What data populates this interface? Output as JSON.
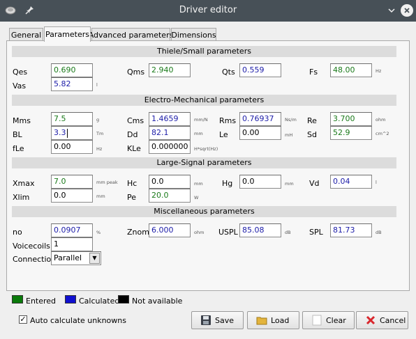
{
  "window": {
    "title": "Driver editor"
  },
  "tabs": [
    "General",
    "Parameters",
    "Advanced parameters",
    "Dimensions"
  ],
  "sections": {
    "ts": "Thiele/Small parameters",
    "em": "Electro-Mechanical parameters",
    "ls": "Large-Signal parameters",
    "misc": "Miscellaneous parameters"
  },
  "params": {
    "qes": {
      "label": "Qes",
      "value": "0.690",
      "unit": ""
    },
    "qms": {
      "label": "Qms",
      "value": "2.940",
      "unit": ""
    },
    "qts": {
      "label": "Qts",
      "value": "0.559",
      "unit": ""
    },
    "fs": {
      "label": "Fs",
      "value": "48.00",
      "unit": "Hz"
    },
    "vas": {
      "label": "Vas",
      "value": "5.82",
      "unit": "l"
    },
    "mms": {
      "label": "Mms",
      "value": "7.5",
      "unit": "g"
    },
    "cms": {
      "label": "Cms",
      "value": "1.4659",
      "unit": "mm/N"
    },
    "rms": {
      "label": "Rms",
      "value": "0.76937",
      "unit": "Ns/m"
    },
    "re": {
      "label": "Re",
      "value": "3.700",
      "unit": "ohm"
    },
    "bl": {
      "label": "BL",
      "value": "3.3",
      "unit": "Tm"
    },
    "dd": {
      "label": "Dd",
      "value": "82.1",
      "unit": "mm"
    },
    "le": {
      "label": "Le",
      "value": "0.00",
      "unit": "mH"
    },
    "sd": {
      "label": "Sd",
      "value": "52.9",
      "unit": "cm^2"
    },
    "fle": {
      "label": "fLe",
      "value": "0.00",
      "unit": "Hz"
    },
    "kle": {
      "label": "KLe",
      "value": "0.000000",
      "unit": "H*sqrt(Hz)"
    },
    "xmax": {
      "label": "Xmax",
      "value": "7.0",
      "unit": "mm peak"
    },
    "hc": {
      "label": "Hc",
      "value": "0.0",
      "unit": "mm"
    },
    "hg": {
      "label": "Hg",
      "value": "0.0",
      "unit": "mm"
    },
    "vd": {
      "label": "Vd",
      "value": "0.04",
      "unit": "l"
    },
    "xlim": {
      "label": "Xlim",
      "value": "0.0",
      "unit": "mm"
    },
    "pe": {
      "label": "Pe",
      "value": "20.0",
      "unit": "W"
    },
    "no": {
      "label": "no",
      "value": "0.0907",
      "unit": "%"
    },
    "znom": {
      "label": "Znom",
      "value": "6.000",
      "unit": "ohm"
    },
    "uspl": {
      "label": "USPL",
      "value": "85.08",
      "unit": "dB"
    },
    "spl": {
      "label": "SPL",
      "value": "81.73",
      "unit": "dB"
    },
    "voicecoils": {
      "label": "Voicecoils",
      "value": "1"
    },
    "connection": {
      "label": "Connection",
      "value": "Parallel"
    }
  },
  "legend": {
    "entered": "Entered",
    "calculated": "Calculated",
    "not_available": "Not available",
    "colors": {
      "entered": "#0a7a0a",
      "calculated": "#1010d0",
      "not_available": "#000000"
    }
  },
  "auto_calc": {
    "label": "Auto calculate unknowns",
    "checked": true
  },
  "buttons": {
    "save": "Save",
    "load": "Load",
    "clear": "Clear",
    "cancel": "Cancel"
  }
}
